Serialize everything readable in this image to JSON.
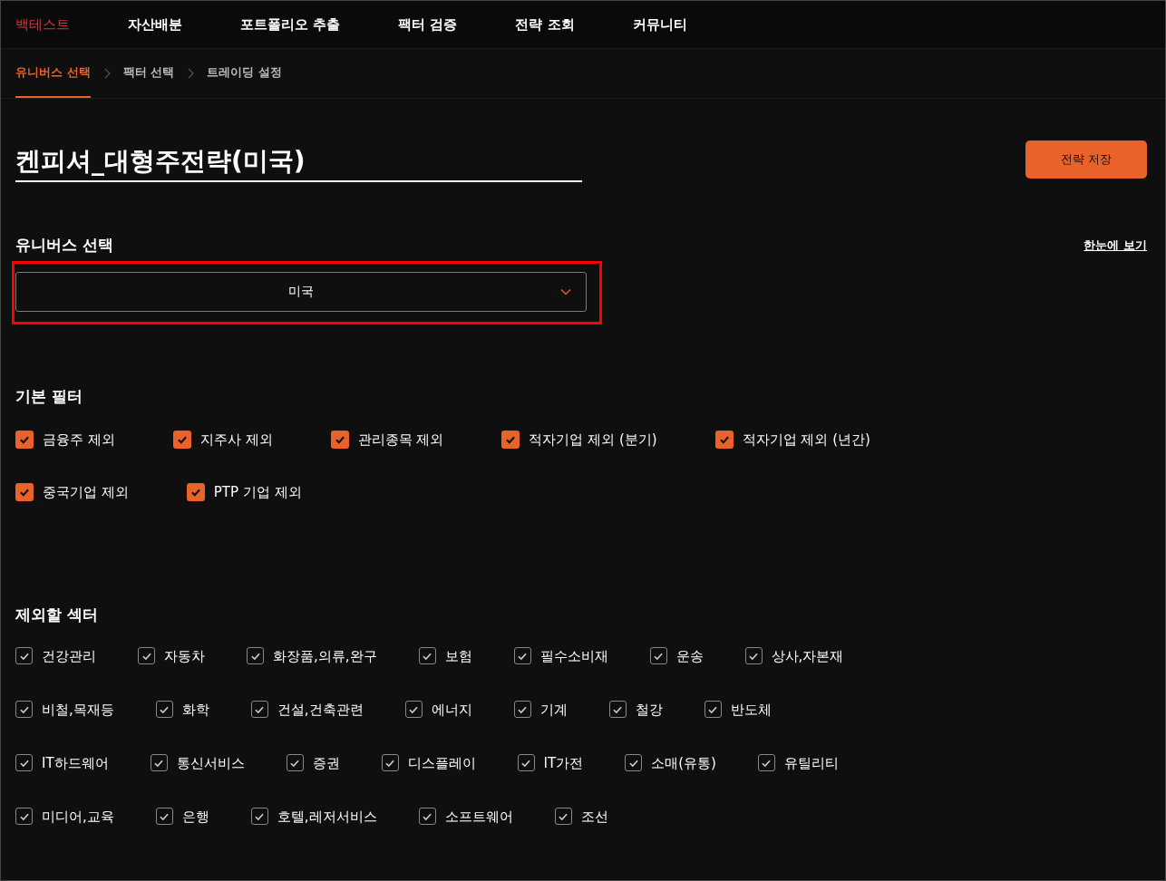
{
  "nav": {
    "brand": "백테스트",
    "items": [
      {
        "label": "자산배분",
        "selected": false
      },
      {
        "label": "포트폴리오 추출",
        "selected": false
      },
      {
        "label": "팩터 검증",
        "selected": false
      },
      {
        "label": "전략 조회",
        "selected": false
      },
      {
        "label": "커뮤니티",
        "selected": false
      }
    ]
  },
  "steps": [
    {
      "label": "유니버스 선택",
      "selected": true
    },
    {
      "label": "팩터 선택",
      "selected": false
    },
    {
      "label": "트레이딩 설정",
      "selected": false
    }
  ],
  "strategy_name": "켄피셔_대형주전략(미국)",
  "save_button": "전략 저장",
  "universe": {
    "heading": "유니버스 선택",
    "overview_link": "한눈에 보기",
    "value": "미국",
    "highlighted": true
  },
  "basic_filters": {
    "heading": "기본 필터",
    "rows": [
      [
        {
          "label": "금융주 제외",
          "checked": true
        },
        {
          "label": "지주사 제외",
          "checked": true
        },
        {
          "label": "관리종목 제외",
          "checked": true
        },
        {
          "label": "적자기업 제외 (분기)",
          "checked": true
        },
        {
          "label": "적자기업 제외 (년간)",
          "checked": true
        }
      ],
      [
        {
          "label": "중국기업 제외",
          "checked": true
        },
        {
          "label": "PTP 기업 제외",
          "checked": true
        }
      ]
    ]
  },
  "sectors": {
    "heading": "제외할 섹터",
    "rows": [
      [
        {
          "label": "건강관리",
          "checked": true
        },
        {
          "label": "자동차",
          "checked": true
        },
        {
          "label": "화장품,의류,완구",
          "checked": true
        },
        {
          "label": "보험",
          "checked": true
        },
        {
          "label": "필수소비재",
          "checked": true
        },
        {
          "label": "운송",
          "checked": true
        },
        {
          "label": "상사,자본재",
          "checked": true
        }
      ],
      [
        {
          "label": "비철,목재등",
          "checked": true
        },
        {
          "label": "화학",
          "checked": true
        },
        {
          "label": "건설,건축관련",
          "checked": true
        },
        {
          "label": "에너지",
          "checked": true
        },
        {
          "label": "기계",
          "checked": true
        },
        {
          "label": "철강",
          "checked": true
        },
        {
          "label": "반도체",
          "checked": true
        }
      ],
      [
        {
          "label": "IT하드웨어",
          "checked": true
        },
        {
          "label": "통신서비스",
          "checked": true
        },
        {
          "label": "증권",
          "checked": true
        },
        {
          "label": "디스플레이",
          "checked": true
        },
        {
          "label": "IT가전",
          "checked": true
        },
        {
          "label": "소매(유통)",
          "checked": true
        },
        {
          "label": "유틸리티",
          "checked": true
        }
      ],
      [
        {
          "label": "미디어,교육",
          "checked": true
        },
        {
          "label": "은행",
          "checked": true
        },
        {
          "label": "호텔,레저서비스",
          "checked": true
        },
        {
          "label": "소프트웨어",
          "checked": true
        },
        {
          "label": "조선",
          "checked": true
        }
      ]
    ]
  }
}
